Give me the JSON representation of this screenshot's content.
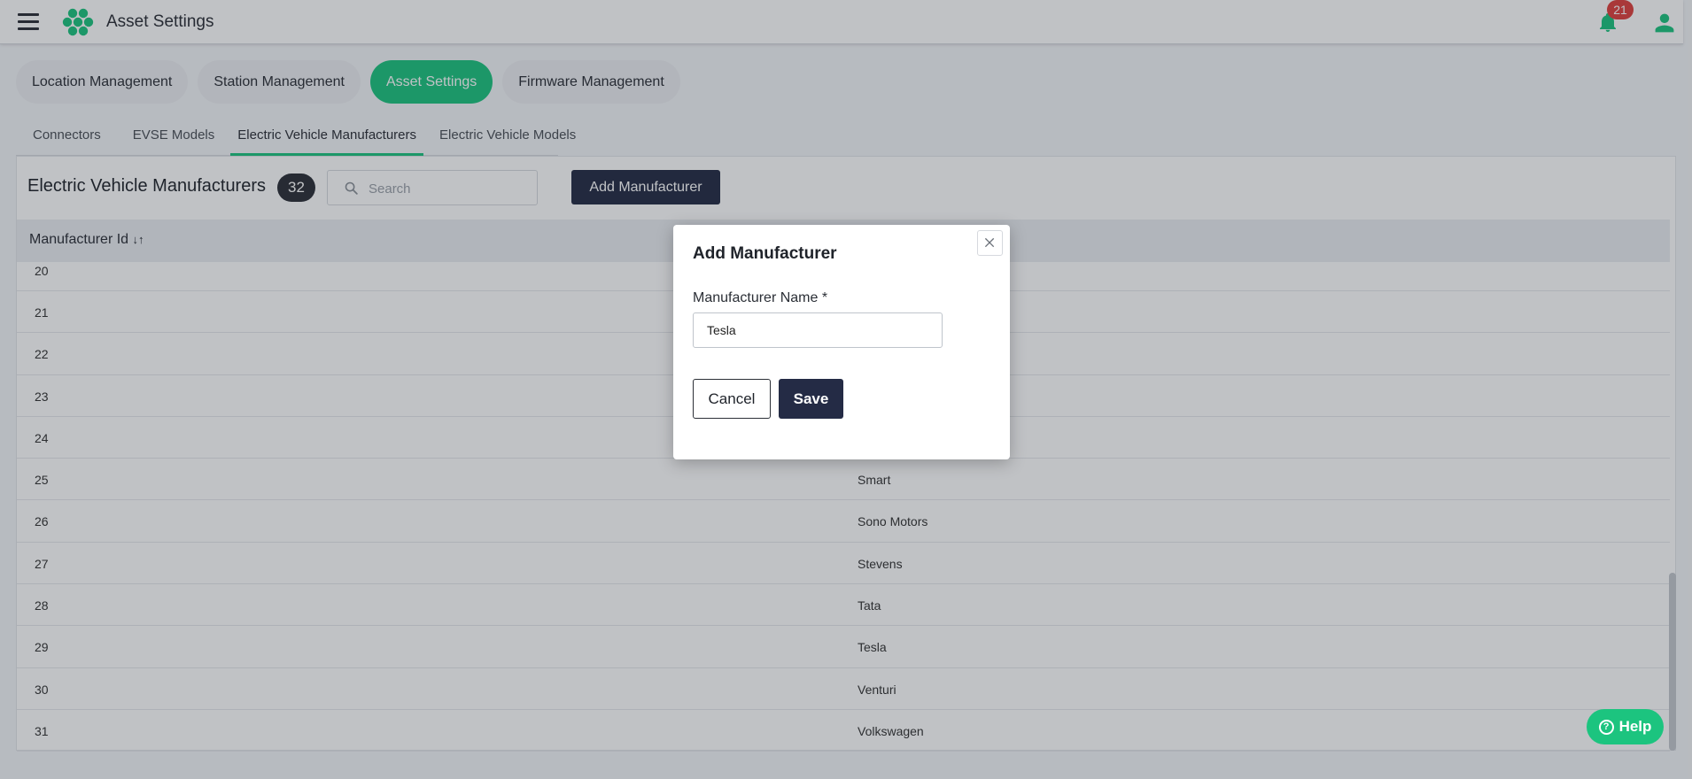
{
  "header": {
    "title": "Asset Settings",
    "notification_count": "21"
  },
  "main_tabs": [
    {
      "label": "Location Management",
      "active": false
    },
    {
      "label": "Station Management",
      "active": false
    },
    {
      "label": "Asset Settings",
      "active": true
    },
    {
      "label": "Firmware Management",
      "active": false
    }
  ],
  "sub_tabs": [
    {
      "label": "Connectors",
      "active": false
    },
    {
      "label": "EVSE Models",
      "active": false
    },
    {
      "label": "Electric Vehicle Manufacturers",
      "active": true
    },
    {
      "label": "Electric Vehicle Models",
      "active": false
    }
  ],
  "panel": {
    "title": "Electric Vehicle Manufacturers",
    "count": "32",
    "search_placeholder": "Search",
    "add_button_label": "Add Manufacturer"
  },
  "table": {
    "columns": [
      {
        "label": "Manufacturer Id",
        "sort_glyph": "↓↑"
      },
      {
        "label": "",
        "sort_glyph": "↓↑"
      }
    ],
    "rows": [
      {
        "id": "20",
        "name": ""
      },
      {
        "id": "21",
        "name": ""
      },
      {
        "id": "22",
        "name": ""
      },
      {
        "id": "23",
        "name": ""
      },
      {
        "id": "24",
        "name": ""
      },
      {
        "id": "25",
        "name": "Smart"
      },
      {
        "id": "26",
        "name": "Sono Motors"
      },
      {
        "id": "27",
        "name": "Stevens"
      },
      {
        "id": "28",
        "name": "Tata"
      },
      {
        "id": "29",
        "name": "Tesla"
      },
      {
        "id": "30",
        "name": "Venturi"
      },
      {
        "id": "31",
        "name": "Volkswagen"
      }
    ]
  },
  "modal": {
    "title": "Add Manufacturer",
    "field_label": "Manufacturer Name *",
    "field_value": "Tesla",
    "cancel_label": "Cancel",
    "save_label": "Save"
  },
  "help": {
    "label": "Help"
  },
  "colors": {
    "accent_green": "#1cc47f",
    "navy": "#242b45",
    "badge_red": "#e0403e"
  },
  "icons": {
    "menu": "hamburger-icon",
    "logo": "hexagon-logo-icon",
    "notifications": "bell-icon",
    "user": "user-icon",
    "search": "search-icon",
    "close": "close-icon",
    "help": "question-circle-icon"
  }
}
